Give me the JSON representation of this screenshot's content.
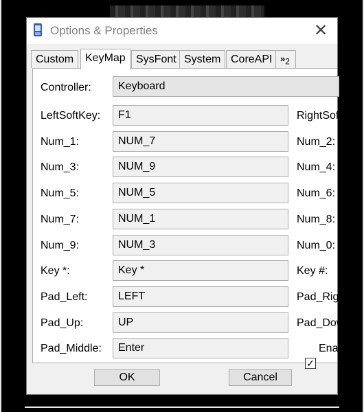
{
  "window": {
    "title": "Options & Properties",
    "close_glyph": "✕"
  },
  "tabs": [
    {
      "label": "Custom",
      "active": false
    },
    {
      "label": "KeyMap",
      "active": true
    },
    {
      "label": "SysFont",
      "active": false
    },
    {
      "label": "System",
      "active": false
    },
    {
      "label": "CoreAPI",
      "active": false
    }
  ],
  "tab_overflow": {
    "arrows": "»",
    "count": "2"
  },
  "controller": {
    "label": "Controller:",
    "value": "Keyboard"
  },
  "rows": [
    {
      "label": "LeftSoftKey:",
      "value": "F1",
      "right_label": "RightSoftKey:"
    },
    {
      "label": "Num_1:",
      "value": "NUM_7",
      "right_label": "Num_2:"
    },
    {
      "label": "Num_3:",
      "value": "NUM_9",
      "right_label": "Num_4:"
    },
    {
      "label": "Num_5:",
      "value": "NUM_5",
      "right_label": "Num_6:"
    },
    {
      "label": "Num_7:",
      "value": "NUM_1",
      "right_label": "Num_8:"
    },
    {
      "label": "Num_9:",
      "value": "NUM_3",
      "right_label": "Num_0:"
    },
    {
      "label": "Key *:",
      "value": "Key *",
      "right_label": "Key #:"
    },
    {
      "label": "Pad_Left:",
      "value": "LEFT",
      "right_label": "Pad_Right:"
    },
    {
      "label": "Pad_Up:",
      "value": "UP",
      "right_label": "Pad_Down:"
    },
    {
      "label": "Pad_Middle:",
      "value": "Enter",
      "right_label": "Enable"
    }
  ],
  "checkbox": {
    "checked": true,
    "glyph": "✓"
  },
  "buttons": {
    "ok": "OK",
    "cancel": "Cancel"
  },
  "colors": {
    "dialog_bg": "#f0f0f0",
    "panel_bg": "#ffffff",
    "field_border": "#adadad"
  }
}
